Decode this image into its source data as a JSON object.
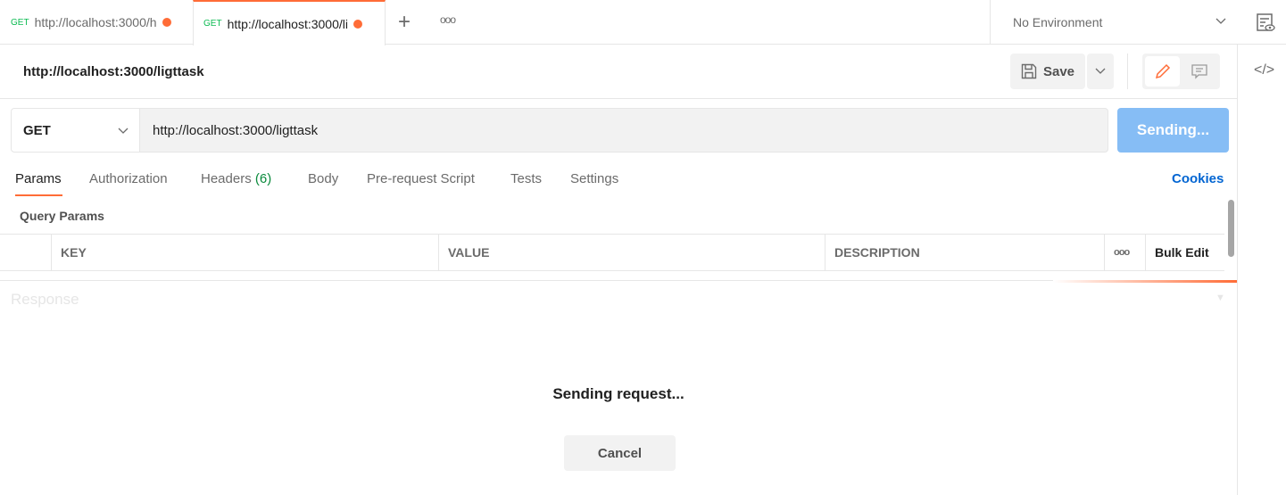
{
  "tabs": [
    {
      "method": "GET",
      "label": "http://localhost:3000/h",
      "unsaved": true
    },
    {
      "method": "GET",
      "label": "http://localhost:3000/li",
      "unsaved": true,
      "active": true
    }
  ],
  "environment": "No Environment",
  "request": {
    "title": "http://localhost:3000/ligttask",
    "method": "GET",
    "url": "http://localhost:3000/ligttask",
    "send_label": "Sending...",
    "save_label": "Save"
  },
  "subtabs": {
    "params": "Params",
    "authorization": "Authorization",
    "headers": "Headers",
    "headers_count": "(6)",
    "body": "Body",
    "prerequest": "Pre-request Script",
    "tests": "Tests",
    "settings": "Settings",
    "cookies": "Cookies"
  },
  "query": {
    "title": "Query Params",
    "columns": [
      "KEY",
      "VALUE",
      "DESCRIPTION"
    ],
    "bulk_edit": "Bulk Edit"
  },
  "response": {
    "title": "Response",
    "status": "Sending request...",
    "cancel": "Cancel"
  },
  "colors": {
    "accent": "#ff6c37",
    "send": "#86bdf5",
    "link": "#0265d2",
    "method_get": "#0cbb52"
  }
}
